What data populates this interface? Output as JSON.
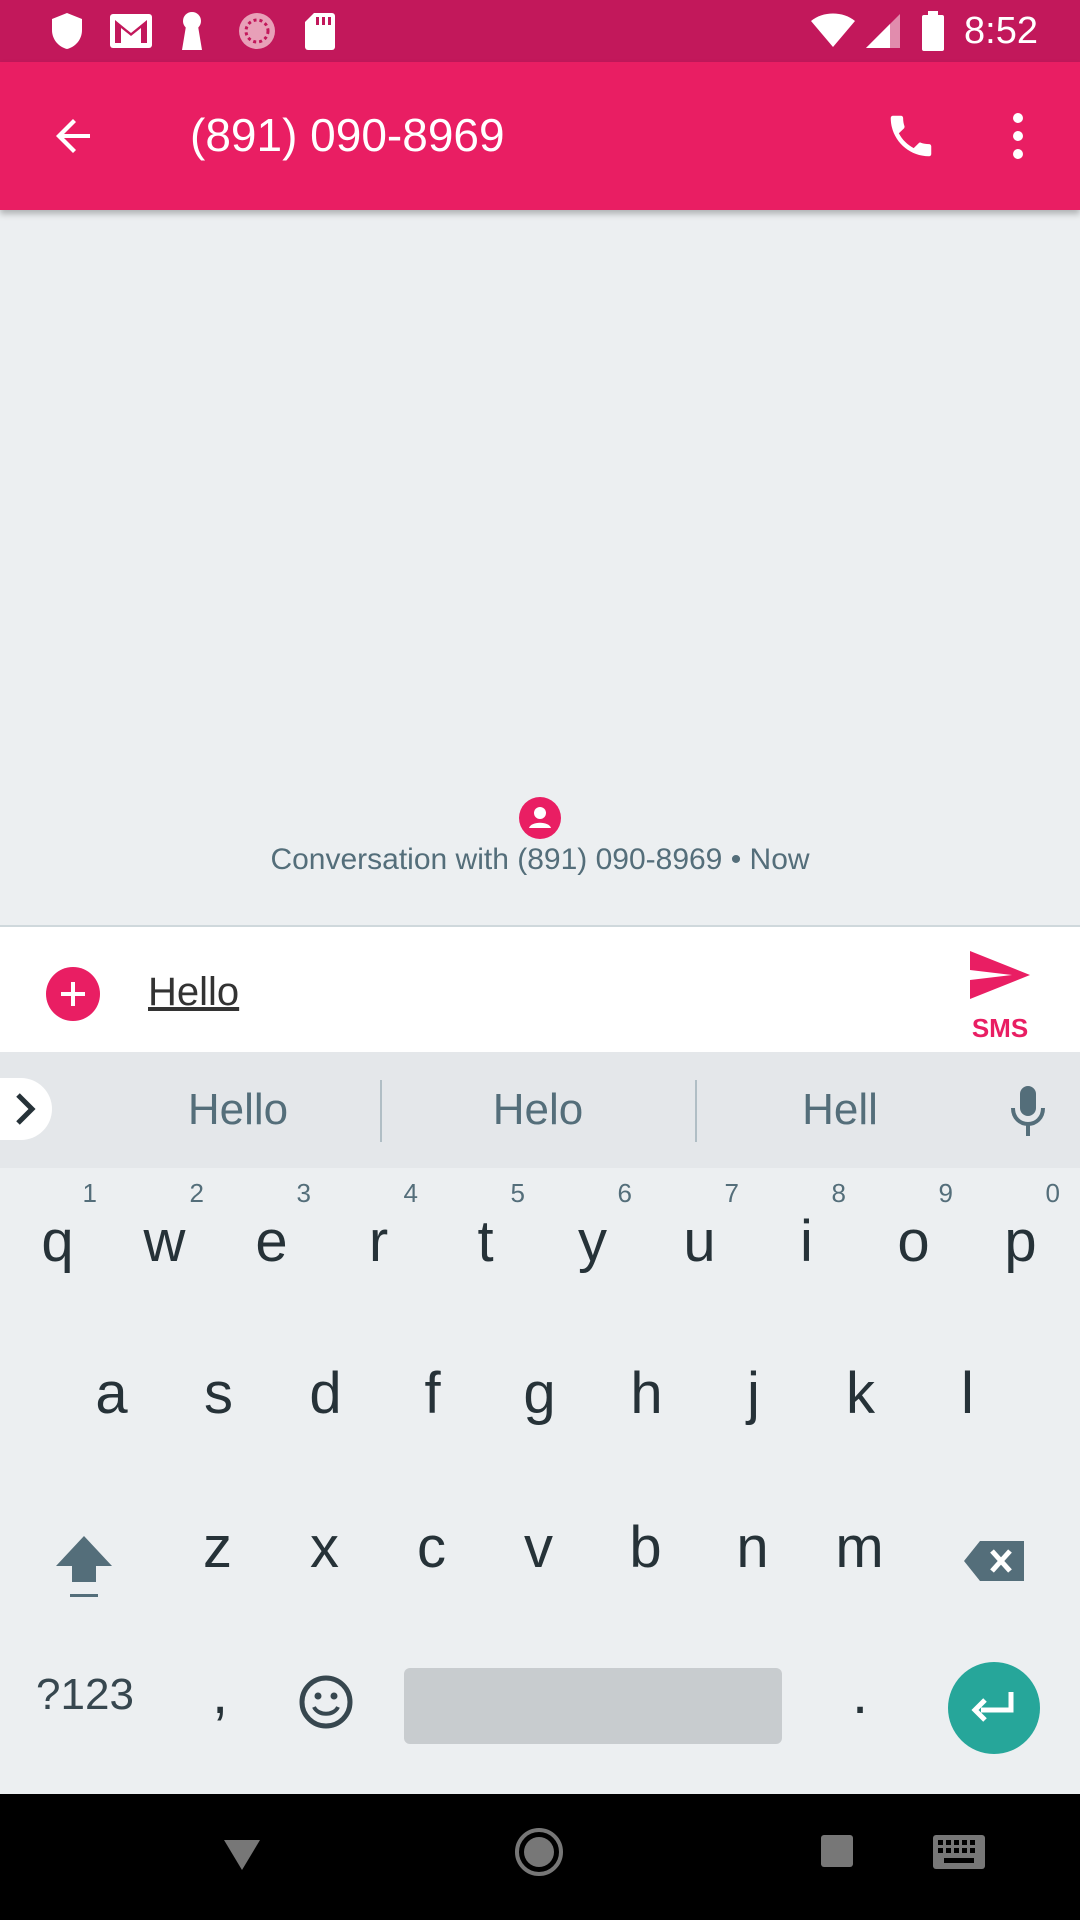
{
  "status_bar": {
    "time": "8:52",
    "left_icons": [
      "shield-icon",
      "gmail-icon",
      "keyhole-icon",
      "loading-icon",
      "sd-card-icon"
    ],
    "right_icons": [
      "wifi-icon",
      "signal-icon",
      "battery-icon"
    ]
  },
  "app_bar": {
    "title": "(891) 090-8969",
    "icons": [
      "back-arrow-icon",
      "phone-icon",
      "more-vert-icon"
    ]
  },
  "conversation": {
    "info": "Conversation with (891) 090-8969 • Now"
  },
  "compose": {
    "text": "Hello",
    "send_label": "SMS"
  },
  "suggestions": [
    "Hello",
    "Helo",
    "Hell"
  ],
  "keyboard": {
    "row1": [
      "q",
      "w",
      "e",
      "r",
      "t",
      "y",
      "u",
      "i",
      "o",
      "p"
    ],
    "row1_hints": [
      "1",
      "2",
      "3",
      "4",
      "5",
      "6",
      "7",
      "8",
      "9",
      "0"
    ],
    "row2": [
      "a",
      "s",
      "d",
      "f",
      "g",
      "h",
      "j",
      "k",
      "l"
    ],
    "row3": [
      "z",
      "x",
      "c",
      "v",
      "b",
      "n",
      "m"
    ],
    "symbols_label": "?123",
    "comma": ",",
    "period": "."
  },
  "colors": {
    "primary": "#e91e63",
    "primary_dark": "#c2185b",
    "enter_key": "#26a69a"
  }
}
